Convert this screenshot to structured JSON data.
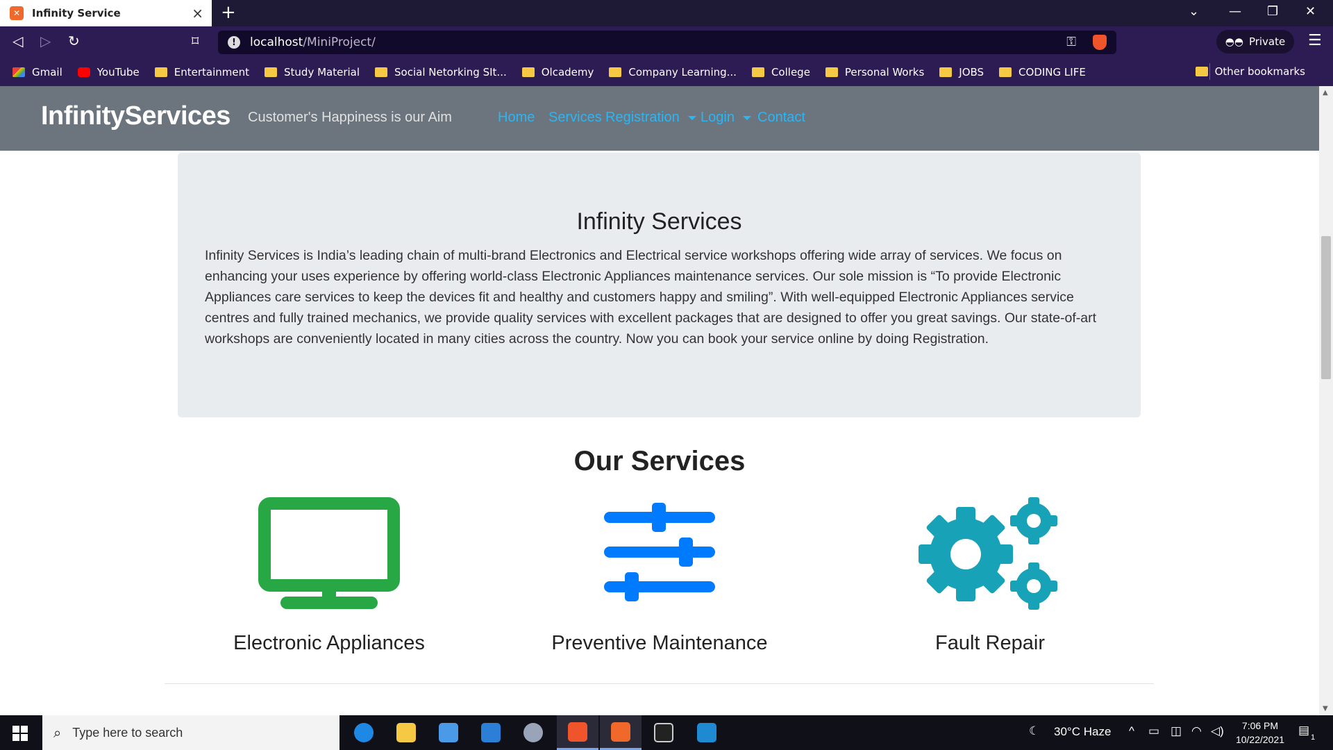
{
  "browser": {
    "tab_title": "Infinity Service",
    "url_host": "localhost",
    "url_path": "/MiniProject/",
    "private_label": "Private",
    "bookmarks": [
      "Gmail",
      "YouTube",
      "Entertainment",
      "Study Material",
      "Social Netorking SIt...",
      "Olcademy",
      "Company Learning...",
      "College",
      "Personal Works",
      "JOBS",
      "CODING LIFE"
    ],
    "other_bookmarks": "Other bookmarks"
  },
  "navbar": {
    "brand": "InfinityServices",
    "tagline": "Customer's Happiness is our Aim",
    "links": {
      "home": "Home",
      "services": "Services",
      "registration": "Registration",
      "login": "Login",
      "contact": "Contact"
    },
    "link_color": "#29b6f6"
  },
  "jumbotron": {
    "title": "Infinity Services",
    "text": "Infinity Services is India’s leading chain of multi-brand Electronics and Electrical service workshops offering wide array of services. We focus on enhancing your uses experience by offering world-class Electronic Appliances maintenance services. Our sole mission is “To provide Electronic Appliances care services to keep the devices fit and healthy and customers happy and smiling”. With well-equipped Electronic Appliances service centres and fully trained mechanics, we provide quality services with excellent packages that are designed to offer you great savings. Our state-of-art workshops are conveniently located in many cities across the country. Now you can book your service online by doing Registration."
  },
  "services": {
    "title": "Our Services",
    "items": [
      {
        "label": "Electronic Appliances",
        "icon": "tv-icon",
        "color": "#28a745"
      },
      {
        "label": "Preventive Maintenance",
        "icon": "sliders-icon",
        "color": "#007bff"
      },
      {
        "label": "Fault Repair",
        "icon": "gears-icon",
        "color": "#17a2b8"
      }
    ]
  },
  "taskbar": {
    "search_placeholder": "Type here to search",
    "weather": "30°C  Haze",
    "time": "7:06 PM",
    "date": "10/22/2021",
    "notification_count": "1"
  }
}
